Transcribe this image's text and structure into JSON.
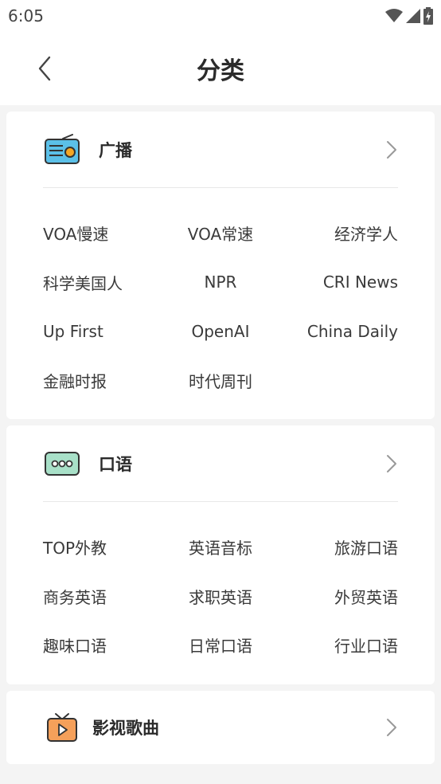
{
  "status": {
    "time": "6:05"
  },
  "header": {
    "title": "分类"
  },
  "categories": [
    {
      "title": "广播",
      "icon": "radio-icon",
      "items": [
        "VOA慢速",
        "VOA常速",
        "经济学人",
        "科学美国人",
        "NPR",
        "CRI News",
        "Up First",
        "OpenAI",
        "China Daily",
        "金融时报",
        "时代周刊"
      ]
    },
    {
      "title": "口语",
      "icon": "speech-bubble-icon",
      "items": [
        "TOP外教",
        "英语音标",
        "旅游口语",
        "商务英语",
        "求职英语",
        "外贸英语",
        "趣味口语",
        "日常口语",
        "行业口语"
      ]
    },
    {
      "title": "影视歌曲",
      "icon": "tv-play-icon",
      "items": []
    }
  ],
  "colors": {
    "accent_orange": "#f5a623",
    "icon_blue": "#5bc0e8",
    "icon_green": "#a8e0c8"
  }
}
